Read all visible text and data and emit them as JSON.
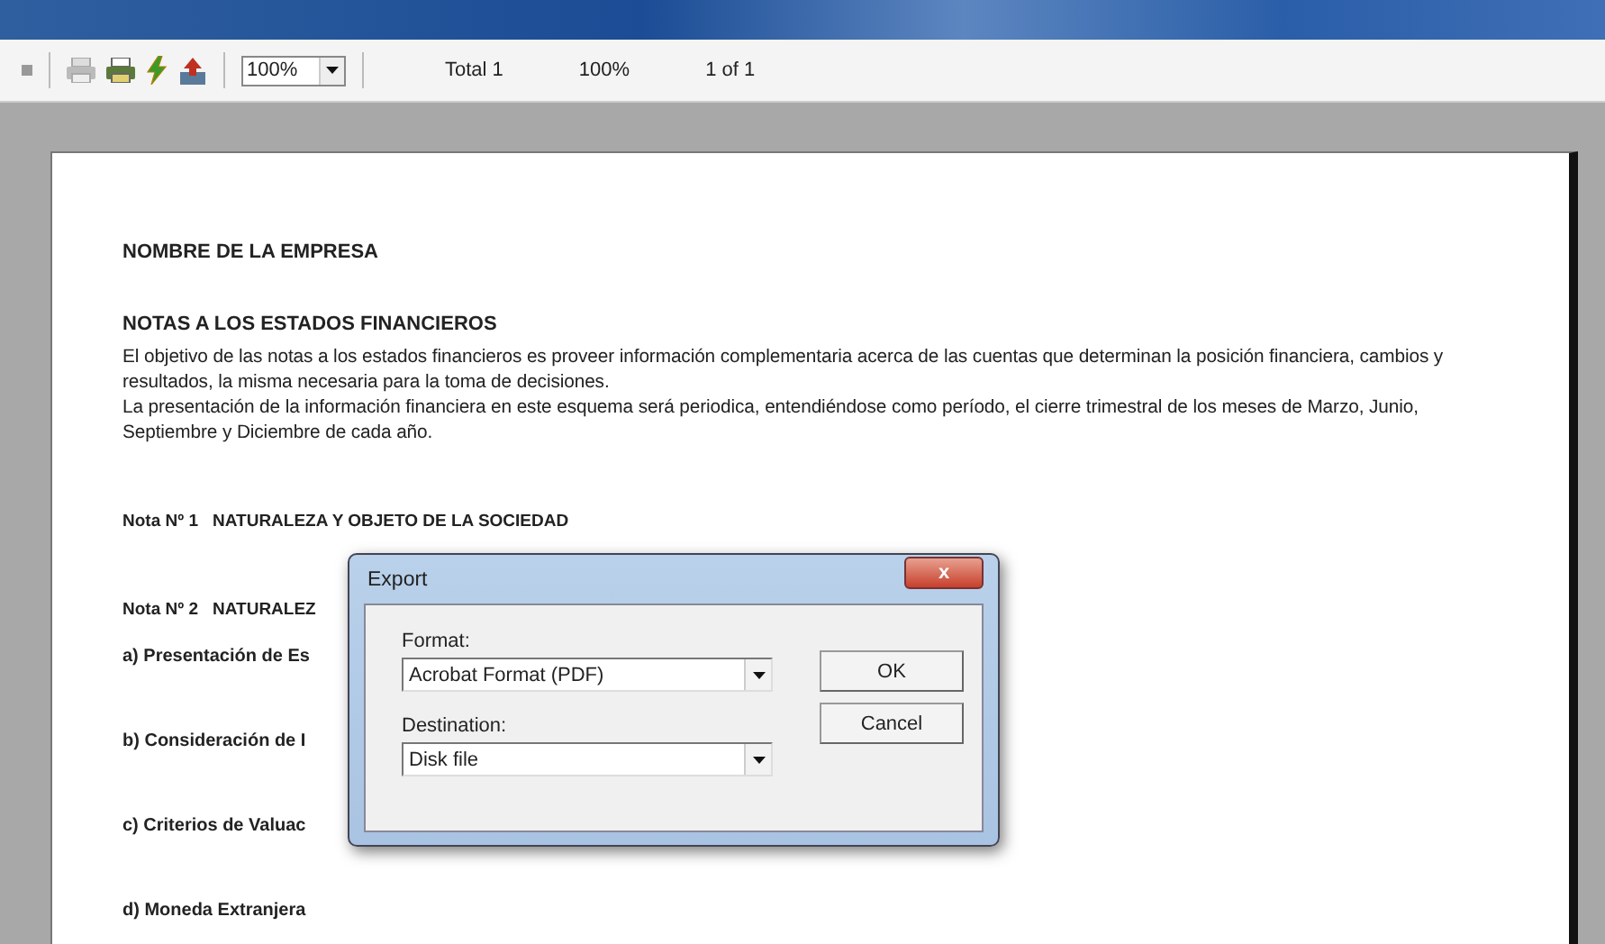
{
  "toolbar": {
    "zoom": "100%",
    "total": "Total 1",
    "percent": "100%",
    "pages": "1 of 1"
  },
  "document": {
    "company": "NOMBRE DE LA EMPRESA",
    "heading": "NOTAS A LOS ESTADOS FINANCIEROS",
    "paragraphs": [
      "El objetivo de las notas a los estados financieros es proveer información complementaria acerca de las cuentas que determinan la posición financiera, cambios y resultados, la misma necesaria para la toma de decisiones.",
      "La presentación de la información financiera en este esquema será periodica, entendiéndose como período, el cierre trimestral de los meses de Marzo, Junio, Septiembre y Diciembre de cada año."
    ],
    "notes": [
      {
        "kind": "note",
        "number": "Nota Nº 1",
        "title": "NATURALEZA Y OBJETO DE LA SOCIEDAD"
      },
      {
        "kind": "note",
        "number": "Nota Nº 2",
        "title": "NATURALEZ"
      },
      {
        "kind": "item",
        "title": "a)  Presentación de Es"
      },
      {
        "kind": "item",
        "title": "b)  Consideración de I"
      },
      {
        "kind": "item",
        "title": "c)  Criterios de Valuac"
      },
      {
        "kind": "item",
        "title": "d)  Moneda Extranjera"
      }
    ]
  },
  "dialog": {
    "title": "Export",
    "close": "x",
    "fields": [
      {
        "label": "Format:",
        "value": "Acrobat Format (PDF)"
      },
      {
        "label": "Destination:",
        "value": "Disk file"
      }
    ],
    "buttons": [
      "OK",
      "Cancel"
    ]
  }
}
